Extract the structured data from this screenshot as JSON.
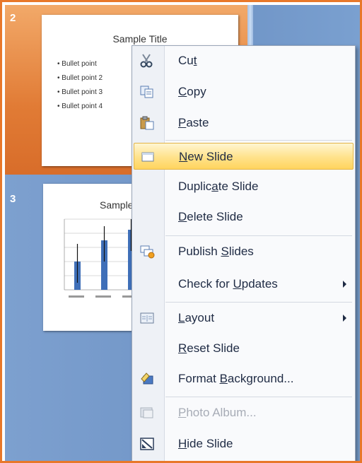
{
  "thumbnails": [
    {
      "number": "2",
      "title": "Sample Title",
      "bullets": [
        "Bullet point",
        "Bullet point 2",
        "Bullet point 3",
        "Bullet point 4"
      ],
      "selected": true
    },
    {
      "number": "3",
      "title": "Sample",
      "chart": {
        "type": "bar",
        "values": [
          40,
          70,
          85
        ],
        "errors": [
          25,
          20,
          15
        ]
      },
      "selected": false
    }
  ],
  "context_menu": {
    "items": [
      {
        "pre": "Cu",
        "acc": "t",
        "post": "",
        "icon": "scissors-icon"
      },
      {
        "pre": "",
        "acc": "C",
        "post": "opy",
        "icon": "copy-icon"
      },
      {
        "pre": "",
        "acc": "P",
        "post": "aste",
        "icon": "paste-icon"
      },
      {
        "pre": "",
        "acc": "N",
        "post": "ew Slide",
        "icon": "new-slide-icon",
        "highlighted": true
      },
      {
        "pre": "Duplic",
        "acc": "a",
        "post": "te Slide"
      },
      {
        "pre": "",
        "acc": "D",
        "post": "elete Slide"
      },
      {
        "pre": "Publish ",
        "acc": "S",
        "post": "lides",
        "icon": "publish-slides-icon"
      },
      {
        "pre": "Check for ",
        "acc": "U",
        "post": "pdates",
        "submenu": true
      },
      {
        "pre": "",
        "acc": "L",
        "post": "ayout",
        "icon": "layout-icon",
        "submenu": true
      },
      {
        "pre": "",
        "acc": "R",
        "post": "eset Slide"
      },
      {
        "pre": "Format ",
        "acc": "B",
        "post": "ackground...",
        "icon": "format-background-icon"
      },
      {
        "pre": "",
        "acc": "P",
        "post": "hoto Album...",
        "icon": "photo-album-icon",
        "disabled": true
      },
      {
        "pre": "",
        "acc": "H",
        "post": "ide Slide",
        "icon": "hide-slide-icon"
      }
    ]
  }
}
